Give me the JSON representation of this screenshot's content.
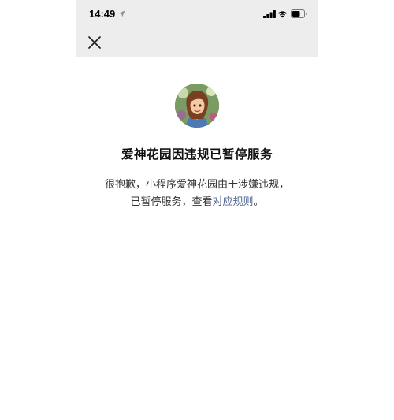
{
  "status_bar": {
    "time": "14:49",
    "icons": [
      "location-arrow-icon",
      "signal-bars-icon",
      "wifi-icon",
      "battery-icon"
    ]
  },
  "nav": {
    "close_icon": "close-icon"
  },
  "main": {
    "title": "爱神花园因违规已暂停服务",
    "desc_line1": "很抱歉，小程序爱神花园由于涉嫌违规，",
    "desc_line2_prefix": "已暂停服务，查看",
    "rules_link": "对应规则",
    "desc_line2_suffix": "。"
  },
  "colors": {
    "topbar_bg": "#ededed",
    "link": "#576b95",
    "page_bg": "#ffffff"
  }
}
